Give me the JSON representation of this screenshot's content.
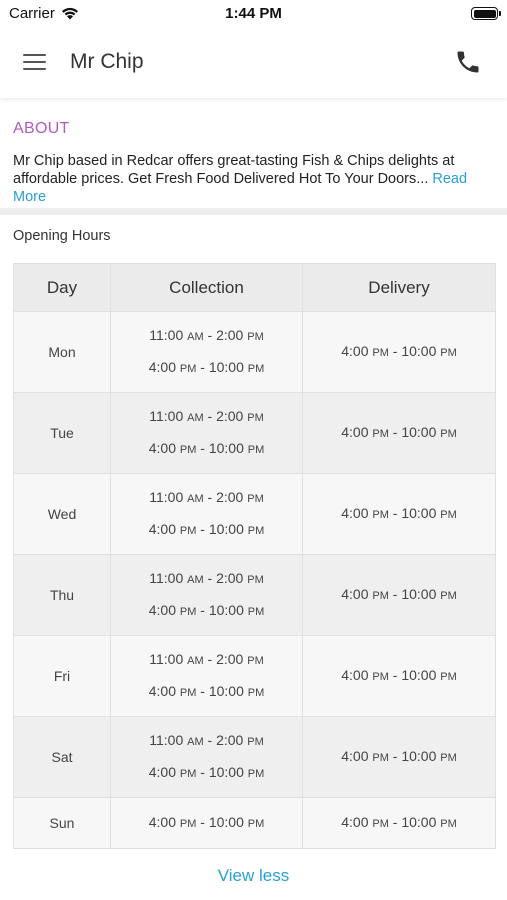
{
  "status_bar": {
    "carrier": "Carrier",
    "time": "1:44 PM",
    "icons": [
      "wifi-icon",
      "battery-icon"
    ]
  },
  "header": {
    "title": "Mr Chip",
    "menu_icon": "hamburger-menu-icon",
    "call_icon": "phone-icon"
  },
  "about": {
    "title": "ABOUT",
    "text": "Mr Chip based in Redcar offers great-tasting Fish & Chips delights at affordable prices. Get Fresh Food Delivered Hot To Your Doors...",
    "read_more": "Read More"
  },
  "opening_hours": {
    "title": "Opening Hours",
    "columns": [
      "Day",
      "Collection",
      "Delivery"
    ],
    "rows": [
      {
        "day": "Mon",
        "collection": [
          "11:00 AM - 2:00 PM",
          "4:00 PM - 10:00 PM"
        ],
        "delivery": "4:00 PM - 10:00 PM"
      },
      {
        "day": "Tue",
        "collection": [
          "11:00 AM - 2:00 PM",
          "4:00 PM - 10:00 PM"
        ],
        "delivery": "4:00 PM - 10:00 PM"
      },
      {
        "day": "Wed",
        "collection": [
          "11:00 AM - 2:00 PM",
          "4:00 PM - 10:00 PM"
        ],
        "delivery": "4:00 PM - 10:00 PM"
      },
      {
        "day": "Thu",
        "collection": [
          "11:00 AM - 2:00 PM",
          "4:00 PM - 10:00 PM"
        ],
        "delivery": "4:00 PM - 10:00 PM"
      },
      {
        "day": "Fri",
        "collection": [
          "11:00 AM - 2:00 PM",
          "4:00 PM - 10:00 PM"
        ],
        "delivery": "4:00 PM - 10:00 PM"
      },
      {
        "day": "Sat",
        "collection": [
          "11:00 AM - 2:00 PM",
          "4:00 PM - 10:00 PM"
        ],
        "delivery": "4:00 PM - 10:00 PM"
      },
      {
        "day": "Sun",
        "collection": [
          "4:00 PM - 10:00 PM"
        ],
        "delivery": "4:00 PM - 10:00 PM"
      }
    ],
    "view_less": "View less"
  },
  "colors": {
    "about_title": "#b25ac3",
    "link": "#2a9fd8",
    "table_header": "#ebebeb",
    "row_light": "#f7f7f7",
    "row_dark": "#efefef"
  }
}
